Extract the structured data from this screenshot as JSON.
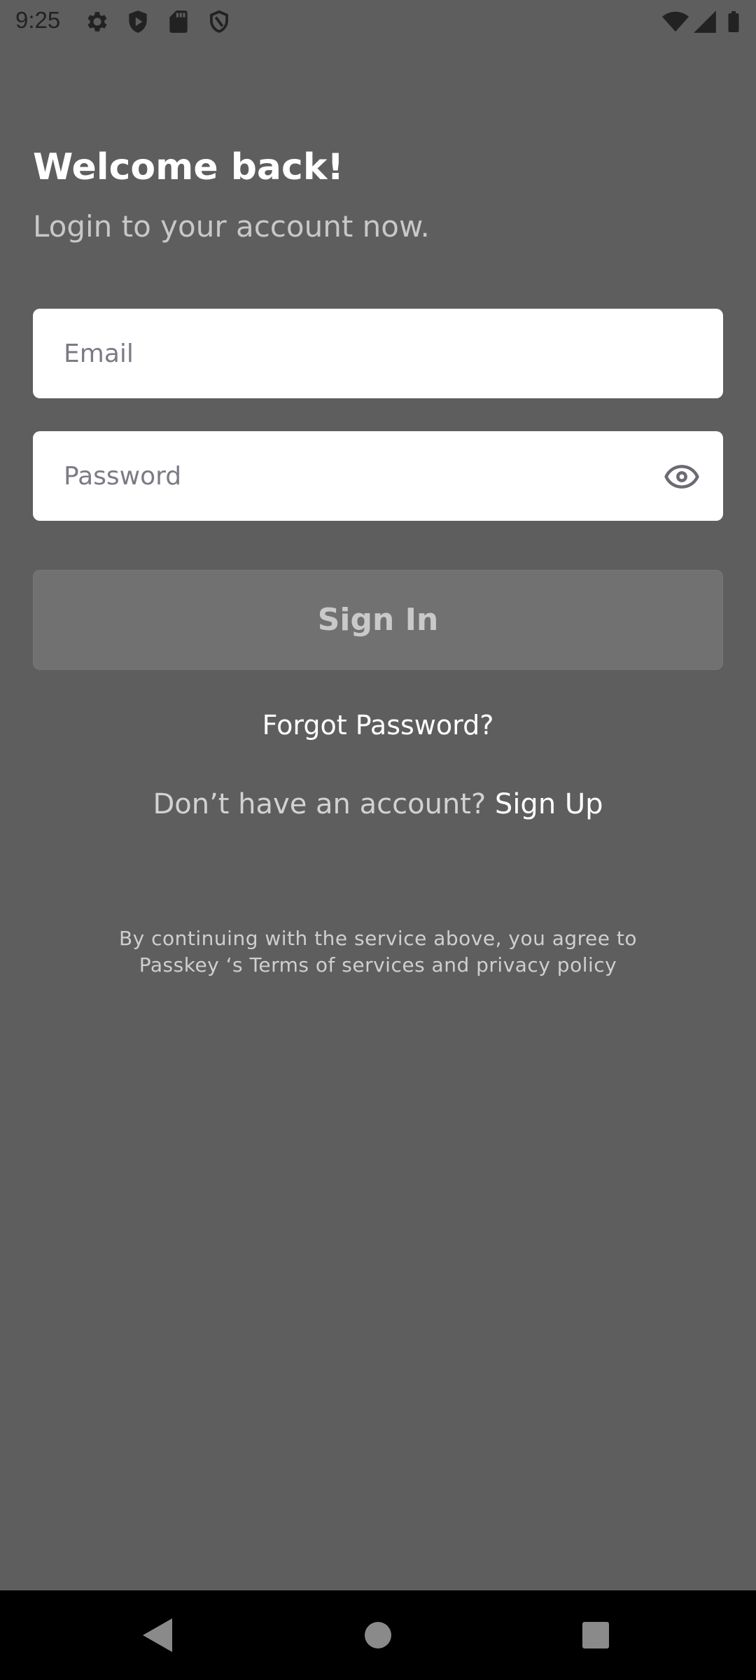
{
  "status_bar": {
    "time": "9:25",
    "left_icons": [
      "gear-icon",
      "play-shield-icon",
      "sd-card-icon",
      "shield-icon"
    ],
    "right_icons": [
      "wifi-icon",
      "signal-icon",
      "battery-icon"
    ],
    "icon_color": "#222222"
  },
  "header": {
    "title": "Welcome back!",
    "subtitle": "Login to your account now."
  },
  "form": {
    "email": {
      "value": "",
      "placeholder": "Email"
    },
    "password": {
      "value": "",
      "placeholder": "Password",
      "toggle_icon": "eye-icon"
    },
    "sign_in_label": "Sign In",
    "forgot_label": "Forgot Password?",
    "signup_prompt": "Don’t have an account? ",
    "signup_label": "Sign Up"
  },
  "legal": {
    "line1": "By continuing with the service above, you agree to",
    "line2": "Passkey ‘s Terms of services and privacy policy"
  },
  "nav_bar": {
    "icons": [
      "back-icon",
      "home-icon",
      "recents-icon"
    ]
  },
  "colors": {
    "background": "#5e5e5e",
    "button_disabled": "#717171",
    "nav_bar": "#000000"
  }
}
